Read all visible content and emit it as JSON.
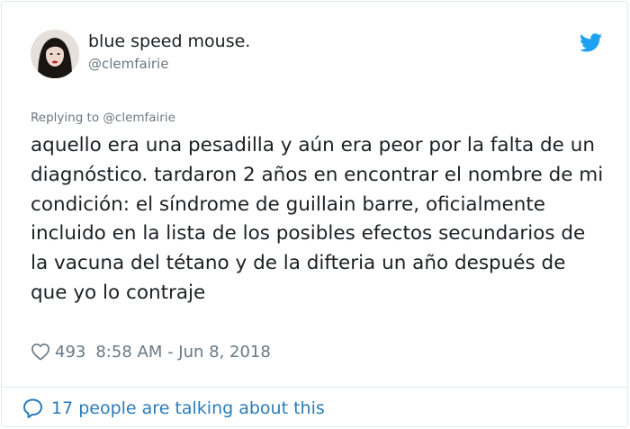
{
  "author": {
    "display_name": "blue speed mouse.",
    "handle": "@clemfairie",
    "avatar_icon": "user-avatar"
  },
  "brand_icon": "twitter-bird-icon",
  "reply_context": "Replying to @clemfairie",
  "tweet": {
    "text": "aquello era una pesadilla y aún era peor por la falta de un diagnóstico. tardaron 2 años en encontrar el nombre de mi condición: el síndrome de guillain barre, oficialmente incluido en la lista de los posibles efectos secundarios de la vacuna del tétano y de la difteria un año después de que yo lo contraje"
  },
  "meta": {
    "likes": "493",
    "timestamp": "8:58 AM - Jun 8, 2018"
  },
  "conversation": {
    "label": "17 people are talking about this"
  },
  "colors": {
    "accent": "#2b7bb9",
    "bird": "#1da1f2",
    "text": "#1c2022",
    "muted": "#697882",
    "border": "#e1e8ed"
  }
}
